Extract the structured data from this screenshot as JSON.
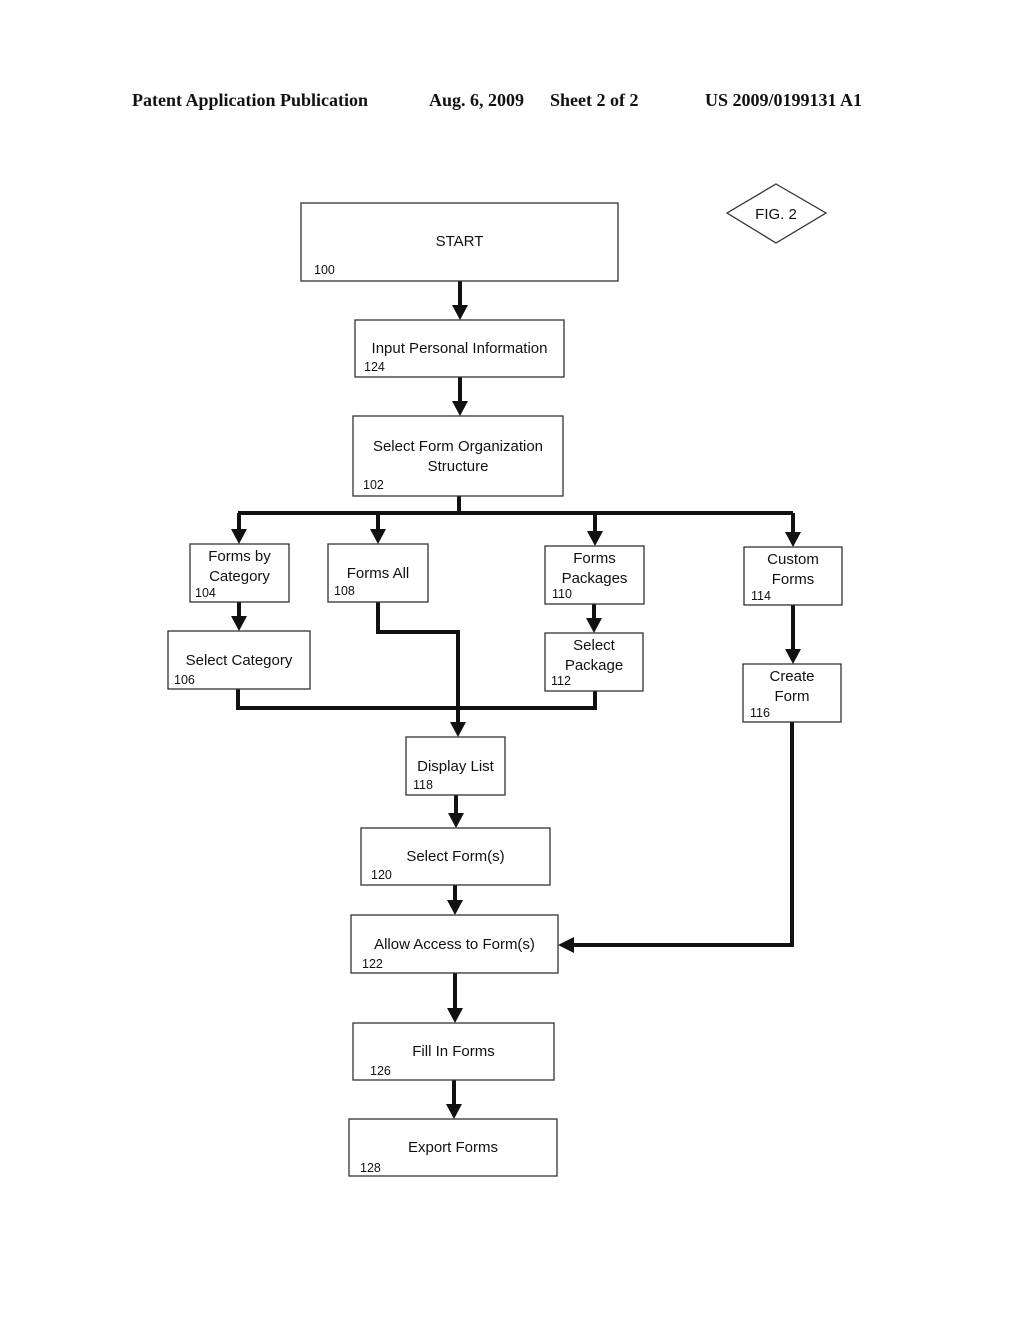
{
  "header": {
    "publication": "Patent Application Publication",
    "date": "Aug. 6, 2009",
    "sheet": "Sheet 2 of 2",
    "number": "US 2009/0199131 A1"
  },
  "figure_label": "FIG. 2",
  "nodes": [
    {
      "id": "100",
      "lines": [
        "START"
      ]
    },
    {
      "id": "124",
      "lines": [
        "Input Personal Information"
      ]
    },
    {
      "id": "102",
      "lines": [
        "Select Form Organization",
        "Structure"
      ]
    },
    {
      "id": "104",
      "lines": [
        "Forms by",
        "Category"
      ]
    },
    {
      "id": "108",
      "lines": [
        "Forms All"
      ]
    },
    {
      "id": "110",
      "lines": [
        "Forms",
        "Packages"
      ]
    },
    {
      "id": "114",
      "lines": [
        "Custom",
        "Forms"
      ]
    },
    {
      "id": "106",
      "lines": [
        "Select Category"
      ]
    },
    {
      "id": "112",
      "lines": [
        "Select",
        "Package"
      ]
    },
    {
      "id": "116",
      "lines": [
        "Create",
        "Form"
      ]
    },
    {
      "id": "118",
      "lines": [
        "Display List"
      ]
    },
    {
      "id": "120",
      "lines": [
        "Select Form(s)"
      ]
    },
    {
      "id": "122",
      "lines": [
        "Allow Access to Form(s)"
      ]
    },
    {
      "id": "126",
      "lines": [
        "Fill In Forms"
      ]
    },
    {
      "id": "128",
      "lines": [
        "Export Forms"
      ]
    }
  ],
  "edges": [
    [
      "100",
      "124"
    ],
    [
      "124",
      "102"
    ],
    [
      "102",
      "104"
    ],
    [
      "102",
      "108"
    ],
    [
      "102",
      "110"
    ],
    [
      "102",
      "114"
    ],
    [
      "104",
      "106"
    ],
    [
      "110",
      "112"
    ],
    [
      "114",
      "116"
    ],
    [
      "106",
      "118"
    ],
    [
      "108",
      "118"
    ],
    [
      "112",
      "118"
    ],
    [
      "118",
      "120"
    ],
    [
      "120",
      "122"
    ],
    [
      "116",
      "122"
    ],
    [
      "122",
      "126"
    ],
    [
      "126",
      "128"
    ]
  ]
}
